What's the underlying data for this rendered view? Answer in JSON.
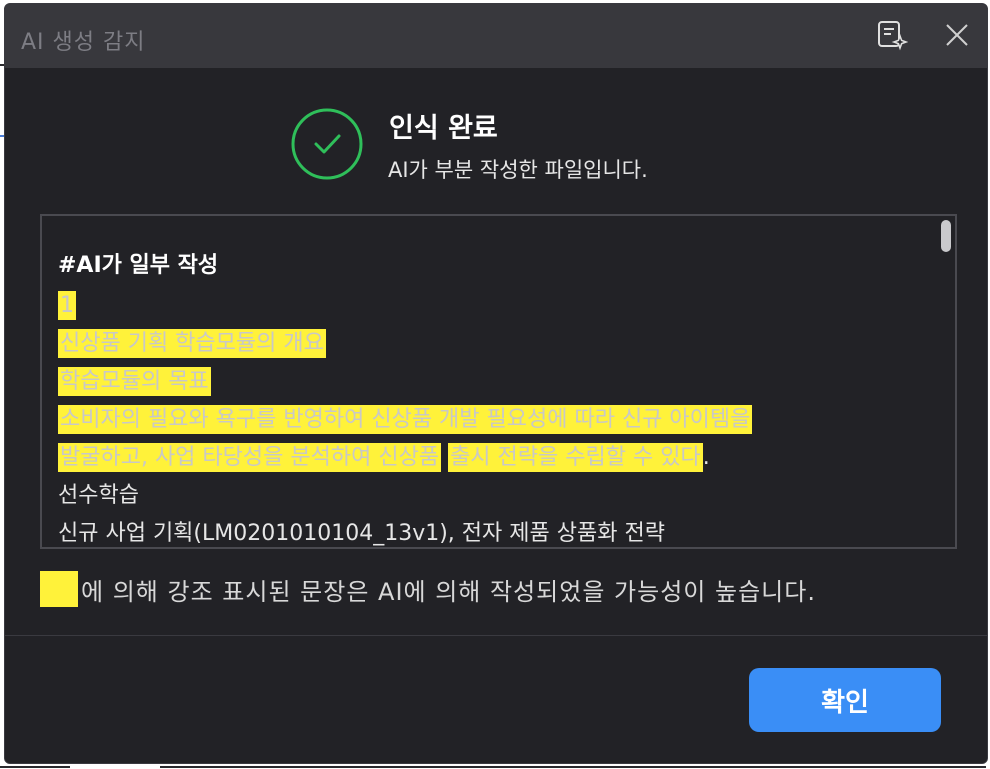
{
  "dialog": {
    "title": "AI 생성 감지",
    "ai_icon": "ai-document-icon",
    "close_icon": "close-icon"
  },
  "status": {
    "icon": "check-circle-icon",
    "title": "인식 완료",
    "subtitle": "AI가 부분 작성한 파일입니다."
  },
  "document": {
    "heading": "#AI가 일부 작성",
    "lines": [
      {
        "segments": [
          {
            "text": "1",
            "highlight": true
          }
        ]
      },
      {
        "segments": [
          {
            "text": "신상품 기획 학습모듈의 개요",
            "highlight": true
          }
        ]
      },
      {
        "segments": [
          {
            "text": "학습모듈의 목표",
            "highlight": true
          }
        ]
      },
      {
        "segments": [
          {
            "text": "소비자의 필요와 욕구를 반영하여 신상품 개발 필요성에 따라 신규 아이템을",
            "highlight": true
          }
        ]
      },
      {
        "segments": [
          {
            "text": "발굴하고, 사업 타당성을 분석하여 신상품",
            "highlight": true
          },
          {
            "text": " ",
            "highlight": false
          },
          {
            "text": "출시 전략을 수립할 수 있다",
            "highlight": true
          },
          {
            "text": ".",
            "highlight": false
          }
        ]
      },
      {
        "segments": [
          {
            "text": "선수학습",
            "highlight": false
          }
        ]
      },
      {
        "segments": [
          {
            "text": "신규 사업 기획(LM0201010104_13v1), 전자 제품 상품화 전략",
            "highlight": false
          }
        ]
      }
    ]
  },
  "legend": {
    "text": "에 의해 강조 표시된 문장은 AI에 의해 작성되었을 가능성이 높습니다.",
    "swatch_color": "#fff23a"
  },
  "actions": {
    "confirm_label": "확인"
  },
  "colors": {
    "accent": "#3a8ef6",
    "success": "#2fbf5a",
    "highlight": "#fff23a"
  }
}
